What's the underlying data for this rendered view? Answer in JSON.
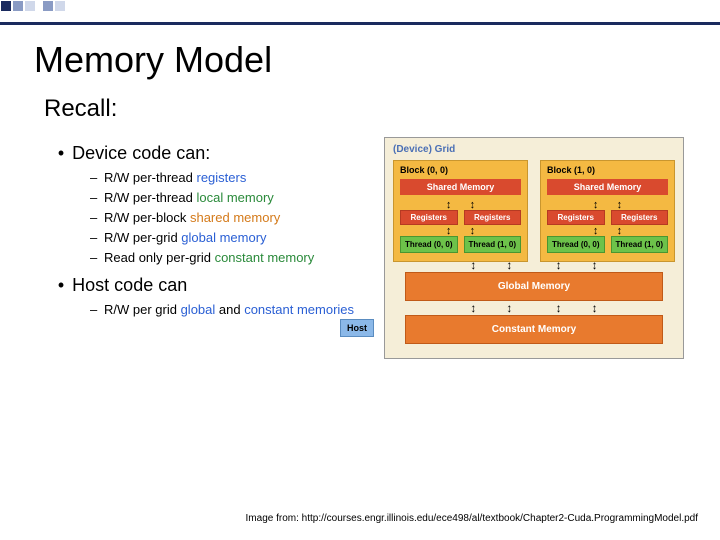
{
  "title": "Memory Model",
  "subtitle": "Recall:",
  "left": {
    "device_header": "Device code can:",
    "items": [
      {
        "pre": "R/W per-thread ",
        "hl": "registers",
        "cls": "hl-b"
      },
      {
        "pre": "R/W per-thread ",
        "hl": "local memory",
        "cls": "hl-g"
      },
      {
        "pre": "R/W per-block ",
        "hl": "shared memory",
        "cls": "hl-o"
      },
      {
        "pre": "R/W per-grid ",
        "hl": "global memory",
        "cls": "hl-b"
      },
      {
        "pre": "Read only per-grid ",
        "hl": "constant memory",
        "cls": "hl-g"
      }
    ],
    "host_header": "Host code can",
    "host_item": {
      "pre": "R/W per grid ",
      "hl1": "global",
      "mid": " and ",
      "hl2": "constant memories",
      "cls": "hl-b"
    }
  },
  "diagram": {
    "grid_label": "(Device) Grid",
    "blocks": [
      "Block (0, 0)",
      "Block (1, 0)"
    ],
    "shared": "Shared Memory",
    "reg": "Registers",
    "threads": [
      [
        "Thread (0, 0)",
        "Thread (1, 0)"
      ],
      [
        "Thread (0, 0)",
        "Thread (1, 0)"
      ]
    ],
    "host": "Host",
    "global": "Global Memory",
    "constant": "Constant Memory"
  },
  "footer": "Image from: http://courses.engr.illinois.edu/ece498/al/textbook/Chapter2-Cuda.ProgrammingModel.pdf"
}
